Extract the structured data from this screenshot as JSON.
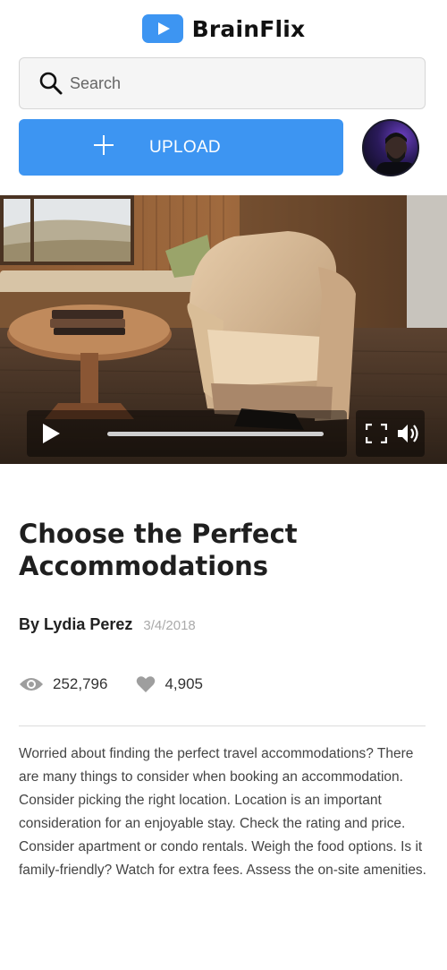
{
  "app": {
    "name": "BrainFlix",
    "brand_color": "#3d95f2"
  },
  "search": {
    "placeholder": "Search",
    "value": ""
  },
  "upload": {
    "label": "UPLOAD"
  },
  "video": {
    "progress": 0,
    "title": "Choose the Perfect Accommodations",
    "author": "By Lydia Perez",
    "date": "3/4/2018",
    "views": "252,796",
    "likes": "4,905",
    "description": "Worried about finding the perfect travel accommodations? There are many things to consider when booking an accommodation. Consider picking the right location. Location is an important consideration for an enjoyable stay. Check the rating and price. Consider apartment or condo rentals. Weigh the food options. Is it family-friendly? Watch for extra fees. Assess the on-site amenities."
  },
  "icons": {
    "logo": "play-logo-icon",
    "search": "search-icon",
    "upload": "plus-icon",
    "play": "play-icon",
    "fullscreen": "fullscreen-icon",
    "volume": "volume-icon",
    "views": "eye-icon",
    "likes": "heart-icon"
  }
}
